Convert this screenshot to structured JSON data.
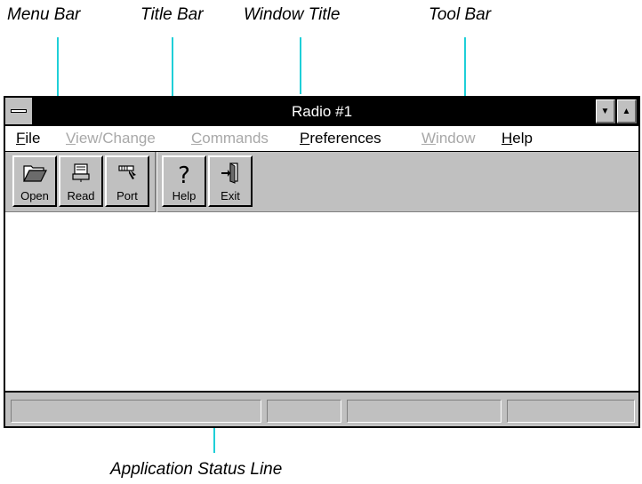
{
  "callouts": {
    "menu_bar": "Menu Bar",
    "title_bar": "Title Bar",
    "window_title": "Window Title",
    "tool_bar": "Tool Bar",
    "status_line": "Application Status Line"
  },
  "window": {
    "title": "Radio #1",
    "minimize_glyph": "▼",
    "maximize_glyph": "▲"
  },
  "menu": {
    "items": [
      {
        "accel": "F",
        "rest": "ile",
        "enabled": true
      },
      {
        "accel": "V",
        "rest": "iew/Change",
        "enabled": false
      },
      {
        "accel": "C",
        "rest": "ommands",
        "enabled": false
      },
      {
        "accel": "P",
        "rest": "references",
        "enabled": true
      },
      {
        "accel": "W",
        "rest": "indow",
        "enabled": false
      },
      {
        "accel": "H",
        "rest": "elp",
        "enabled": true
      }
    ]
  },
  "toolbar": {
    "buttons": [
      {
        "label": "Open",
        "icon": "folder-open-icon"
      },
      {
        "label": "Read",
        "icon": "read-radio-icon"
      },
      {
        "label": "Port",
        "icon": "port-connector-icon"
      },
      {
        "label": "Help",
        "icon": "question-mark-icon"
      },
      {
        "label": "Exit",
        "icon": "exit-door-icon"
      }
    ]
  },
  "status": {
    "panels": [
      "",
      "",
      "",
      ""
    ]
  },
  "colors": {
    "callout_line": "#1fcfd8",
    "title_bar": "#000000",
    "chrome": "#c0c0c0",
    "disabled_text": "#a8a8a8"
  }
}
